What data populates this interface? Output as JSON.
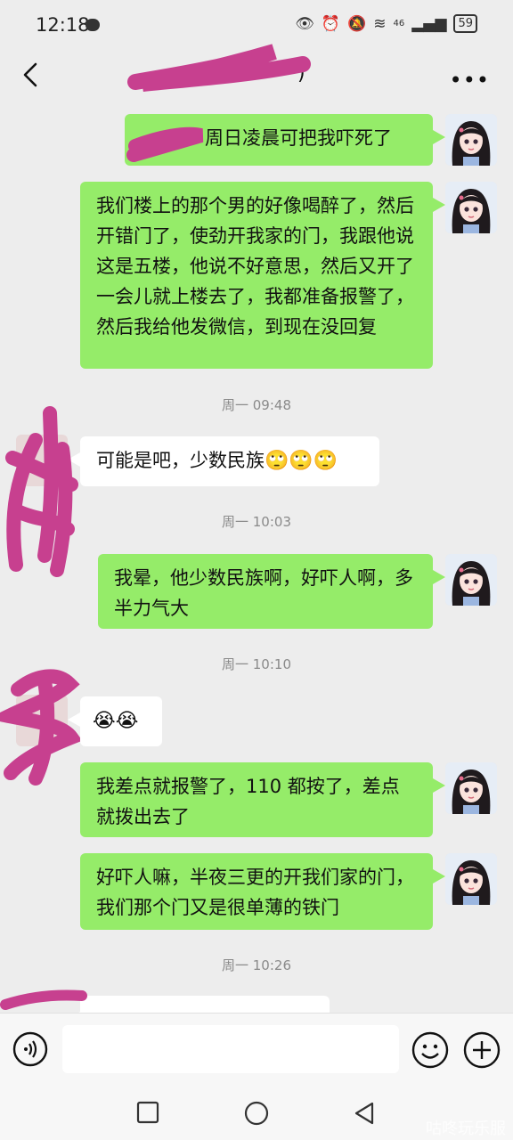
{
  "status_bar": {
    "time": "12:18",
    "network": "46",
    "battery": "59"
  },
  "header": {
    "title": ")",
    "more": "•••"
  },
  "messages": [
    {
      "text": "周日凌晨可把我吓死了"
    },
    {
      "text": "我们楼上的那个男的好像喝醉了，然后开错门了，使劲开我家的门，我跟他说这是五楼，他说不好意思，然后又开了一会儿就上楼去了，我都准备报警了，然后我给他发微信，到现在没回复"
    },
    {
      "time": "周一 09:48"
    },
    {
      "text": "可能是吧，少数民族",
      "emoji": "🙄🙄🙄"
    },
    {
      "time": "周一 10:03"
    },
    {
      "text": "我晕，他少数民族啊，好吓人啊，多半力气大"
    },
    {
      "time": "周一 10:10"
    },
    {
      "emoji": "😭😭"
    },
    {
      "text": "我差点就报警了，110 都按了，差点就拨出去了"
    },
    {
      "text": "好吓人嘛，半夜三更的开我们家的门，我们那个门又是很单薄的铁门"
    },
    {
      "time": "周一 10:26"
    }
  ],
  "watermark": "咕咚玩乐服",
  "colors": {
    "bg": "#ededed",
    "me_bubble": "#95ec69",
    "other_bubble": "#ffffff",
    "scribble": "#c7408f"
  }
}
